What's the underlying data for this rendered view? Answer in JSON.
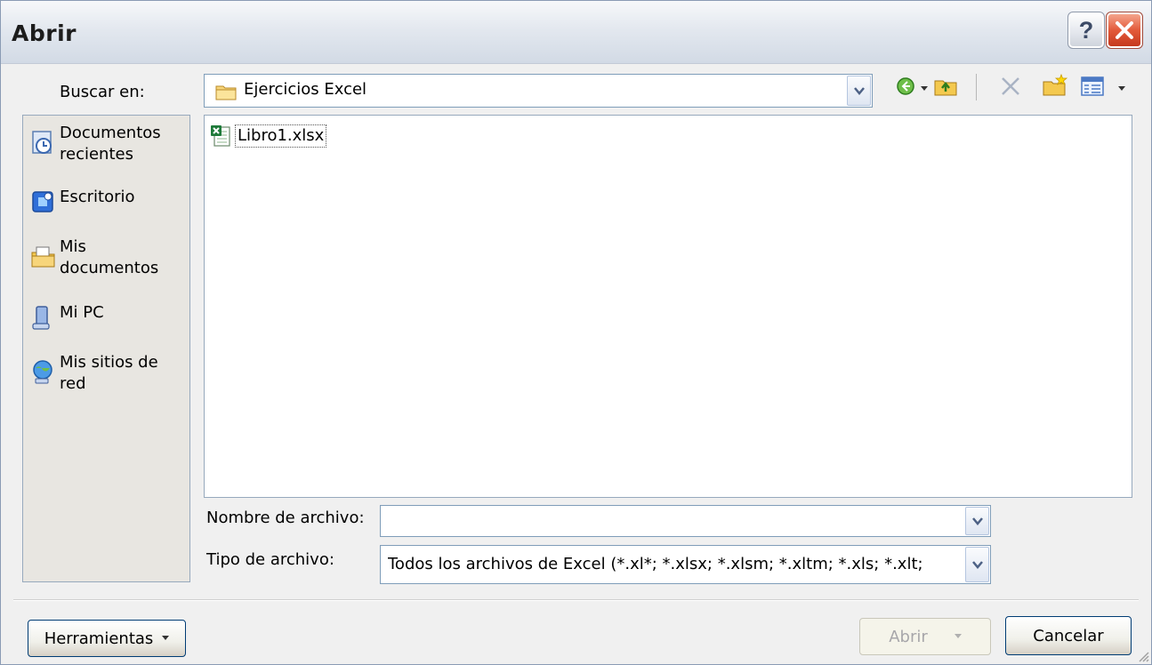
{
  "window": {
    "title": "Abrir"
  },
  "toolbar": {
    "look_in_label": "Buscar en:",
    "look_in_value": "Ejercicios Excel"
  },
  "places": [
    {
      "label": "Documentos\nrecientes",
      "icon": "recent-documents-icon"
    },
    {
      "label": "Escritorio",
      "icon": "desktop-icon"
    },
    {
      "label": "Mis\ndocumentos",
      "icon": "my-documents-icon"
    },
    {
      "label": "Mi PC",
      "icon": "my-computer-icon"
    },
    {
      "label": "Mis sitios de\nred",
      "icon": "network-places-icon"
    }
  ],
  "files": [
    {
      "name": "Libro1.xlsx",
      "icon": "excel-file-icon"
    }
  ],
  "form": {
    "filename_label": "Nombre de archivo:",
    "filename_value": "",
    "filetype_label": "Tipo de archivo:",
    "filetype_value": "Todos los archivos de Excel (*.xl*; *.xlsx; *.xlsm; *.xltm; *.xls; *.xlt;"
  },
  "buttons": {
    "tools": "Herramientas",
    "open": "Abrir",
    "cancel": "Cancelar"
  },
  "colors": {
    "close_red": "#e35a3a",
    "border_blue": "#7f9db9"
  }
}
